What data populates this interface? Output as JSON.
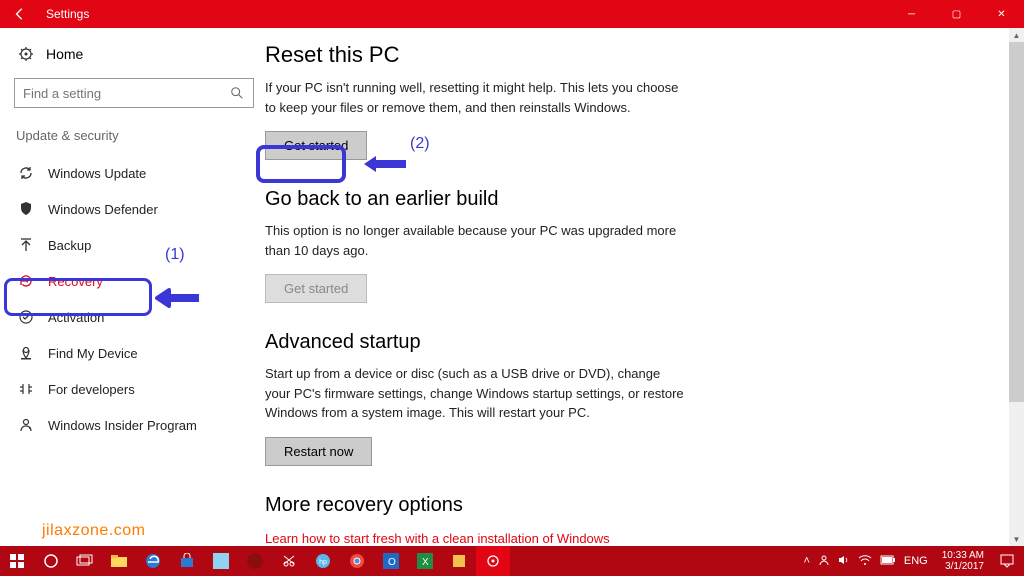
{
  "titlebar": {
    "title": "Settings"
  },
  "sidebar": {
    "home": "Home",
    "search_placeholder": "Find a setting",
    "category": "Update & security",
    "items": [
      {
        "label": "Windows Update"
      },
      {
        "label": "Windows Defender"
      },
      {
        "label": "Backup"
      },
      {
        "label": "Recovery"
      },
      {
        "label": "Activation"
      },
      {
        "label": "Find My Device"
      },
      {
        "label": "For developers"
      },
      {
        "label": "Windows Insider Program"
      }
    ]
  },
  "main": {
    "reset": {
      "heading": "Reset this PC",
      "body": "If your PC isn't running well, resetting it might help. This lets you choose to keep your files or remove them, and then reinstalls Windows.",
      "button": "Get started"
    },
    "goback": {
      "heading": "Go back to an earlier build",
      "body": "This option is no longer available because your PC was upgraded more than 10 days ago.",
      "button": "Get started"
    },
    "advanced": {
      "heading": "Advanced startup",
      "body": "Start up from a device or disc (such as a USB drive or DVD), change your PC's firmware settings, change Windows startup settings, or restore Windows from a system image. This will restart your PC.",
      "button": "Restart now"
    },
    "more": {
      "heading": "More recovery options",
      "link": "Learn how to start fresh with a clean installation of Windows"
    }
  },
  "annotations": {
    "label1": "(1)",
    "label2": "(2)"
  },
  "watermark": "jilaxzone.com",
  "taskbar": {
    "lang": "ENG",
    "time": "10:33 AM",
    "date": "3/1/2017"
  }
}
